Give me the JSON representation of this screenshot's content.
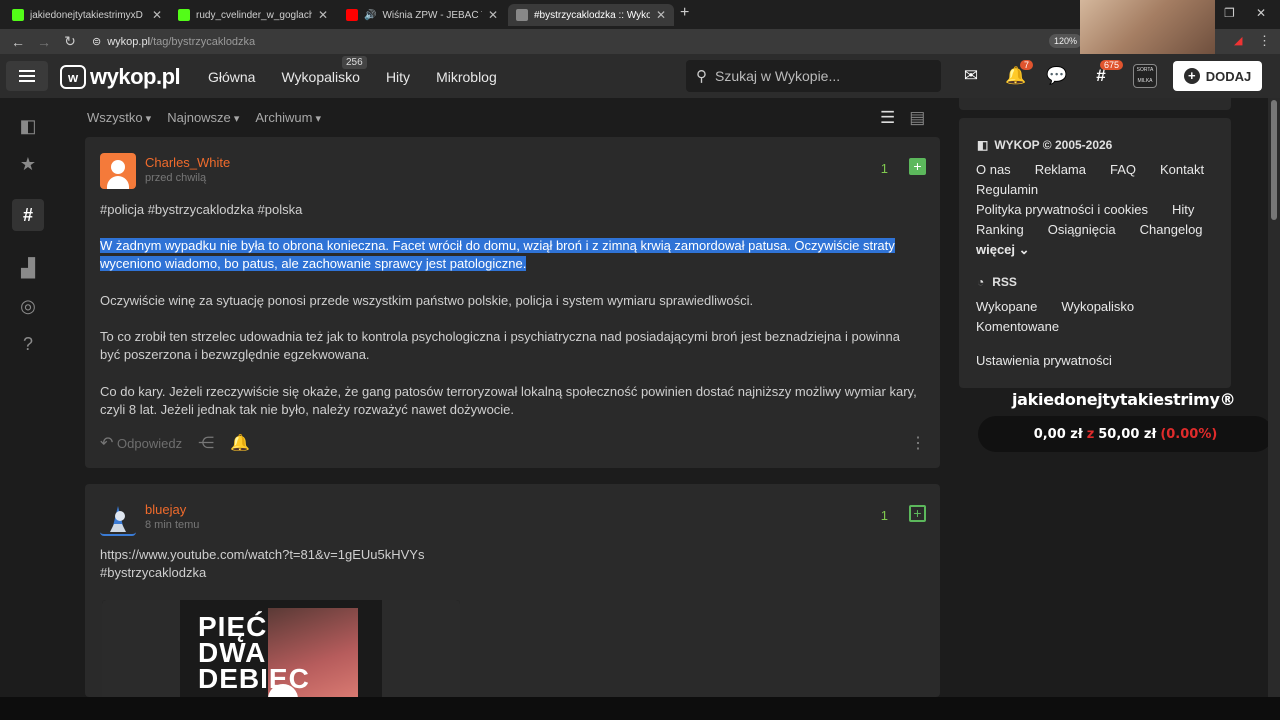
{
  "browser": {
    "tabs": [
      {
        "title": "jakiedonejtytakiestrimyxD Strea",
        "color": "#53fc18"
      },
      {
        "title": "rudy_cvelinder_w_goglach Strea",
        "color": "#53fc18"
      },
      {
        "title": "Wiśnia ZPW - JEBAĆ TE KUR",
        "color": "#ff0000"
      },
      {
        "title": "#bystrzycaklodzka :: Wykop.pl",
        "color": "#888888"
      }
    ],
    "url_domain": "wykop.pl",
    "url_path": "/tag/bystrzycaklodzka",
    "zoom": "120%"
  },
  "header": {
    "logo": "wykop.pl",
    "nav": [
      "Główna",
      "Wykopalisko",
      "Hity",
      "Mikroblog"
    ],
    "wykopalisko_count": "256",
    "search_placeholder": "Szukaj w Wykopie...",
    "notif_count": "7",
    "tag_count": "675",
    "avatar_text": "SORTA MILKA",
    "add_button": "DODAJ"
  },
  "filters": [
    "Wszystko",
    "Najnowsze",
    "Archiwum"
  ],
  "posts": [
    {
      "author": "Charles_White",
      "time": "przed chwilą",
      "votes": "1",
      "tags": "#policja #bystrzycaklodzka #polska",
      "highlighted": "W żadnym wypadku nie była to obrona konieczna. Facet wrócił do domu, wziął broń i z zimną krwią zamordował patusa. Oczywiście straty wyceniono wiadomo, bo patus, ale zachowanie sprawcy jest patologiczne.",
      "p2": "Oczywiście winę za sytuację ponosi przede wszystkim państwo polskie, policja i system wymiaru sprawiedliwości.",
      "p3": "To co zrobił ten strzelec udowadnia też jak to kontrola psychologiczna i psychiatryczna nad posiadającymi broń jest beznadziejna i powinna być poszerzona i bezwzględnie egzekwowana.",
      "p4": "Co do kary. Jeżeli rzeczywiście się okaże, że gang patosów terroryzował lokalną społeczność powinien dostać najniższy możliwy wymiar kary, czyli 8 lat. Jeżeli jednak tak nie było, należy rozważyć nawet dożywocie.",
      "reply": "Odpowiedz"
    },
    {
      "author": "bluejay",
      "time": "8 min temu",
      "votes": "1",
      "link": "https://www.youtube.com/watch?t=81&v=1gEUu5kHVYs",
      "tag": "#bystrzycaklodzka",
      "thumb_text": "PIĘĆ DWA DEBIEC"
    }
  ],
  "right": {
    "copyright": "WYKOP © 2005-2026",
    "links": [
      "O nas",
      "Reklama",
      "FAQ",
      "Kontakt",
      "Regulamin",
      "Polityka prywatności i cookies",
      "Hity",
      "Ranking",
      "Osiągnięcia",
      "Changelog"
    ],
    "more": "więcej",
    "rss": "RSS",
    "rss_links": [
      "Wykopane",
      "Wykopalisko",
      "Komentowane"
    ],
    "privacy": "Ustawienia prywatności"
  },
  "overlay": {
    "title": "jakiedonejtytakiestrimy®",
    "amount": "0,00 zł",
    "sep": "z",
    "goal": "50,00 zł",
    "percent": "(0.00%)"
  }
}
